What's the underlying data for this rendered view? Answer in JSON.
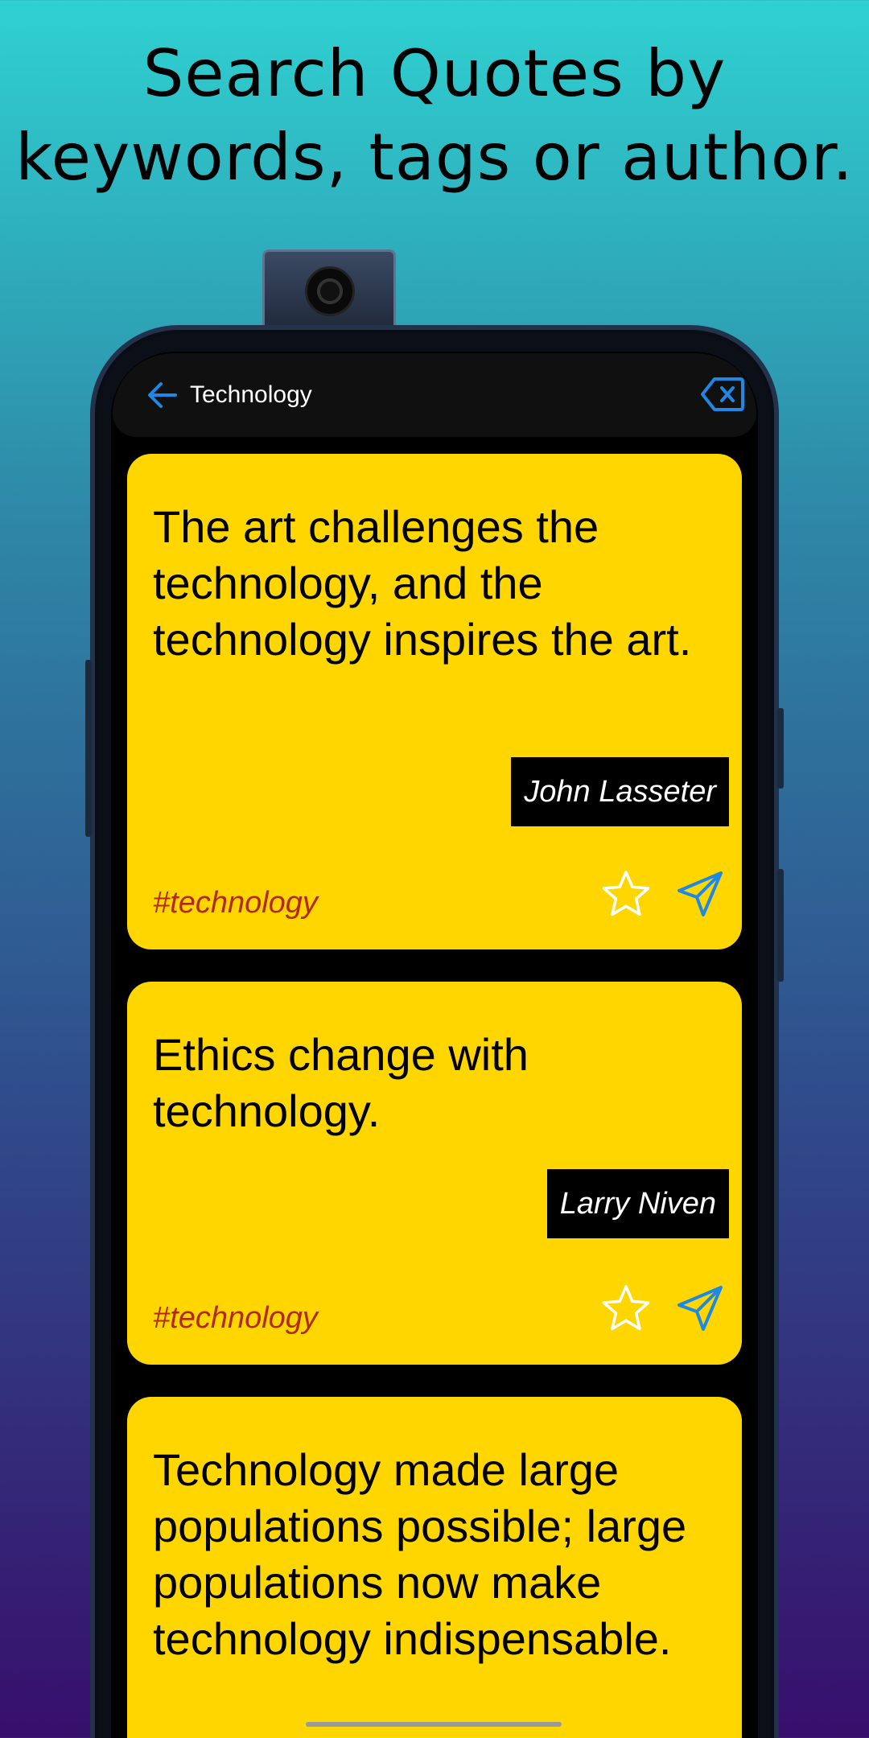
{
  "headline": {
    "line1": "Search Quotes by",
    "line2": "keywords, tags or author."
  },
  "appbar": {
    "title": "Technology",
    "back_icon": "arrow-left-icon",
    "clear_icon": "backspace-clear-icon",
    "accent_color": "#1e88e5"
  },
  "quotes": [
    {
      "text": "The art challenges the technology, and the technology inspires the art.",
      "author": "John Lasseter",
      "tag": "#technology"
    },
    {
      "text": "Ethics change with technology.",
      "author": "Larry Niven",
      "tag": "#technology"
    },
    {
      "text": "Technology made large populations possible; large populations now make technology indispensable.",
      "author": "",
      "tag": ""
    }
  ],
  "colors": {
    "card": "#ffd600",
    "tag": "#b32a14",
    "star": "#ffffff",
    "send": "#1e88e5"
  }
}
